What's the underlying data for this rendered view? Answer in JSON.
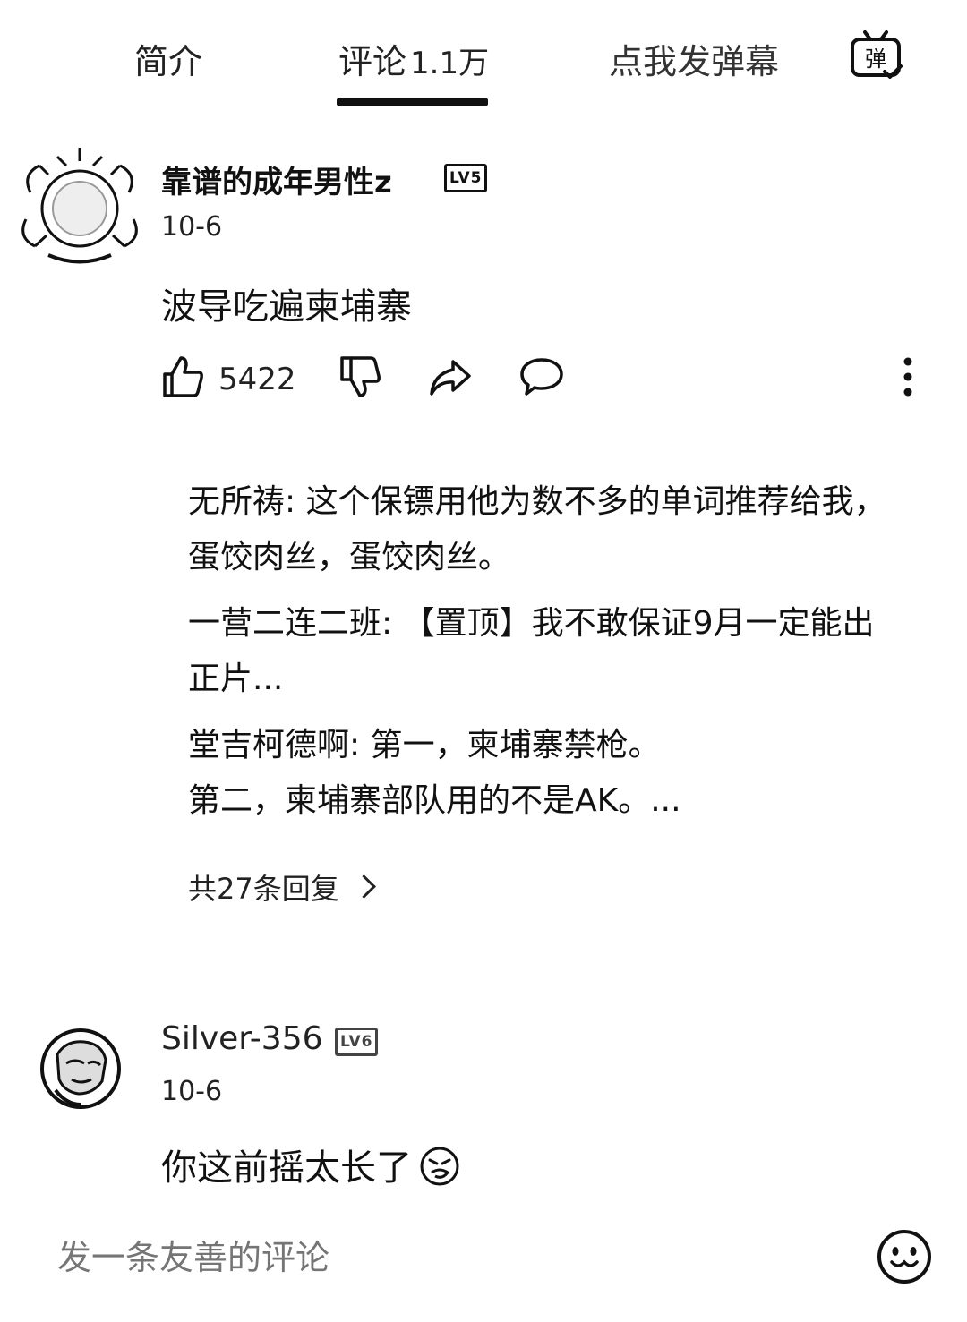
{
  "tabs": {
    "intro": "简介",
    "comments": "评论",
    "comments_count": "1.1万",
    "danmaku": "点我发弹幕",
    "danmaku_icon_text": "弹"
  },
  "comments": [
    {
      "username": "靠谱的成年男性z",
      "level": "LV5",
      "date": "10-6",
      "text": "波导吃遍柬埔寨",
      "likes": "5422",
      "replies": [
        {
          "author": "无所祷",
          "text": ": 这个保镖用他为数不多的单词推荐给我，蛋饺肉丝，蛋饺肉丝。"
        },
        {
          "author": "一营二连二班",
          "text": ": 【置顶】我不敢保证9月一定能出正片..."
        },
        {
          "author": "堂吉柯德啊",
          "text": ": 第一，柬埔寨禁枪。\n第二，柬埔寨部队用的不是AK。..."
        }
      ],
      "reply_count": "共27条回复"
    },
    {
      "username": "Silver-356",
      "level": "LV6",
      "date": "10-6",
      "text": "你这前摇太长了"
    }
  ],
  "composer": {
    "placeholder": "发一条友善的评论"
  },
  "icons": {
    "like": "thumbs-up-icon",
    "dislike": "thumbs-down-icon",
    "share": "share-icon",
    "reply": "reply-bubble-icon",
    "more": "more-vertical-icon",
    "emoji": "emoji-icon",
    "danmaku": "danmaku-icon"
  }
}
